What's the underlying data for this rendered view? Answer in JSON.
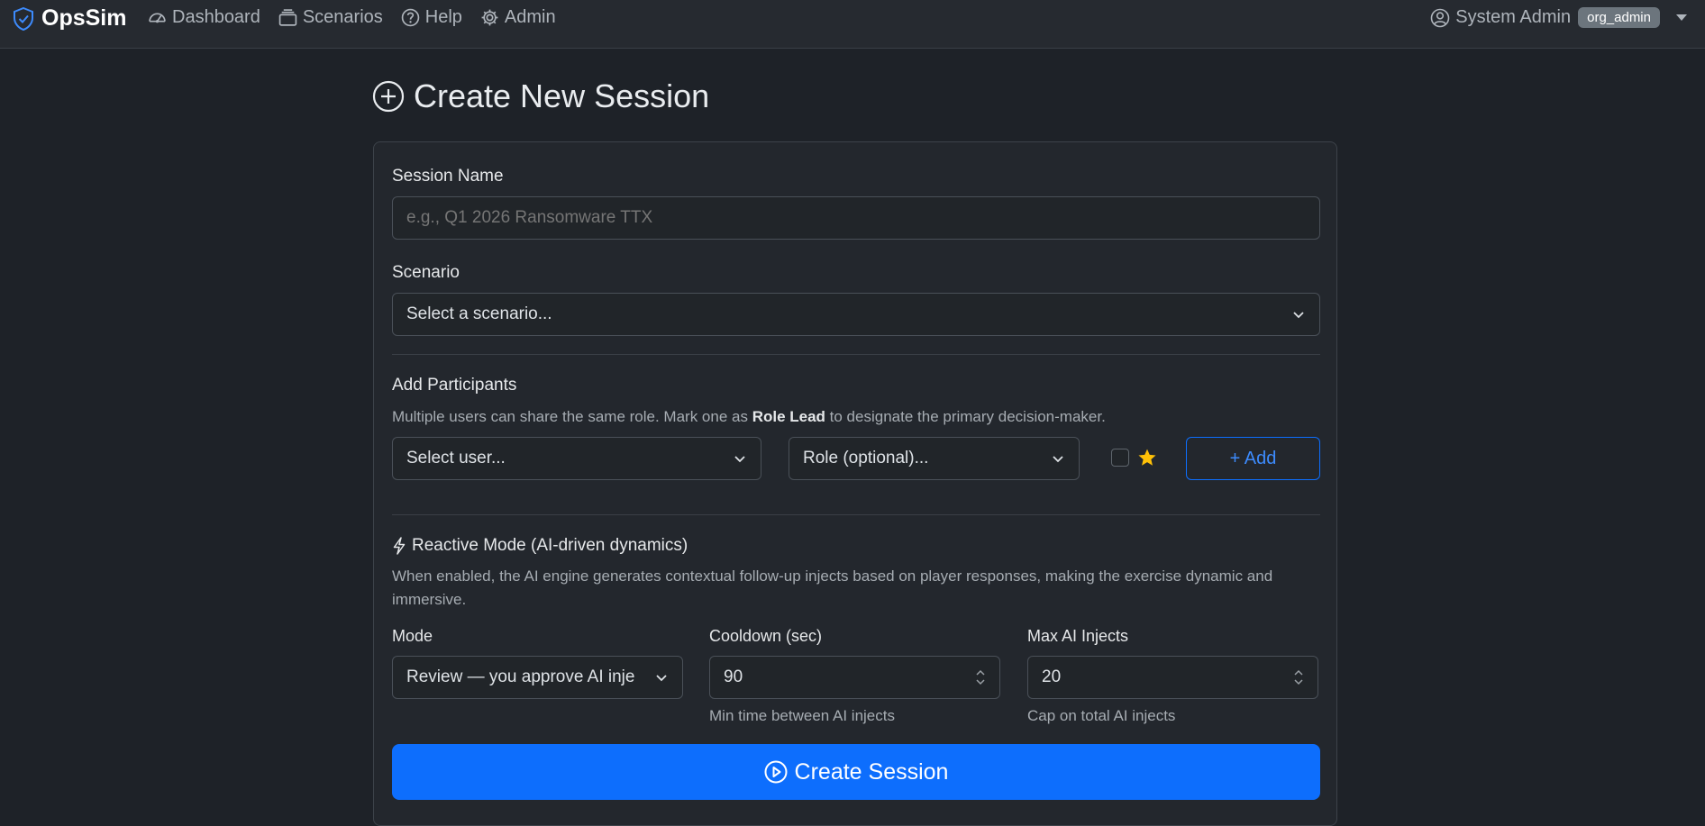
{
  "nav": {
    "brand": "OpsSim",
    "items": [
      {
        "label": "Dashboard",
        "icon": "speedometer-icon"
      },
      {
        "label": "Scenarios",
        "icon": "collection-icon"
      },
      {
        "label": "Help",
        "icon": "question-circle-icon"
      },
      {
        "label": "Admin",
        "icon": "gear-icon"
      }
    ],
    "user_name": "System Admin",
    "user_role_badge": "org_admin"
  },
  "page": {
    "title": "Create New Session"
  },
  "form": {
    "session_name_label": "Session Name",
    "session_name_placeholder": "e.g., Q1 2026 Ransomware TTX",
    "scenario_label": "Scenario",
    "scenario_value": "Select a scenario...",
    "participants_title": "Add Participants",
    "participants_help_pre": "Multiple users can share the same role. Mark one as ",
    "participants_help_bold": "Role Lead",
    "participants_help_post": " to designate the primary decision-maker.",
    "user_select_value": "Select user...",
    "role_select_value": "Role (optional)...",
    "add_button": "+ Add",
    "reactive_title": "Reactive Mode (AI-driven dynamics)",
    "reactive_help": "When enabled, the AI engine generates contextual follow-up injects based on player responses, making the exercise dynamic and immersive.",
    "mode_label": "Mode",
    "mode_value": "Review — you approve AI inje",
    "cooldown_label": "Cooldown (sec)",
    "cooldown_value": "90",
    "cooldown_help": "Min time between AI injects",
    "max_label": "Max AI Injects",
    "max_value": "20",
    "max_help": "Cap on total AI injects",
    "create_button": "Create Session"
  },
  "colors": {
    "primary": "#0d6efd",
    "star": "#ffc107",
    "background": "#1e2228"
  }
}
